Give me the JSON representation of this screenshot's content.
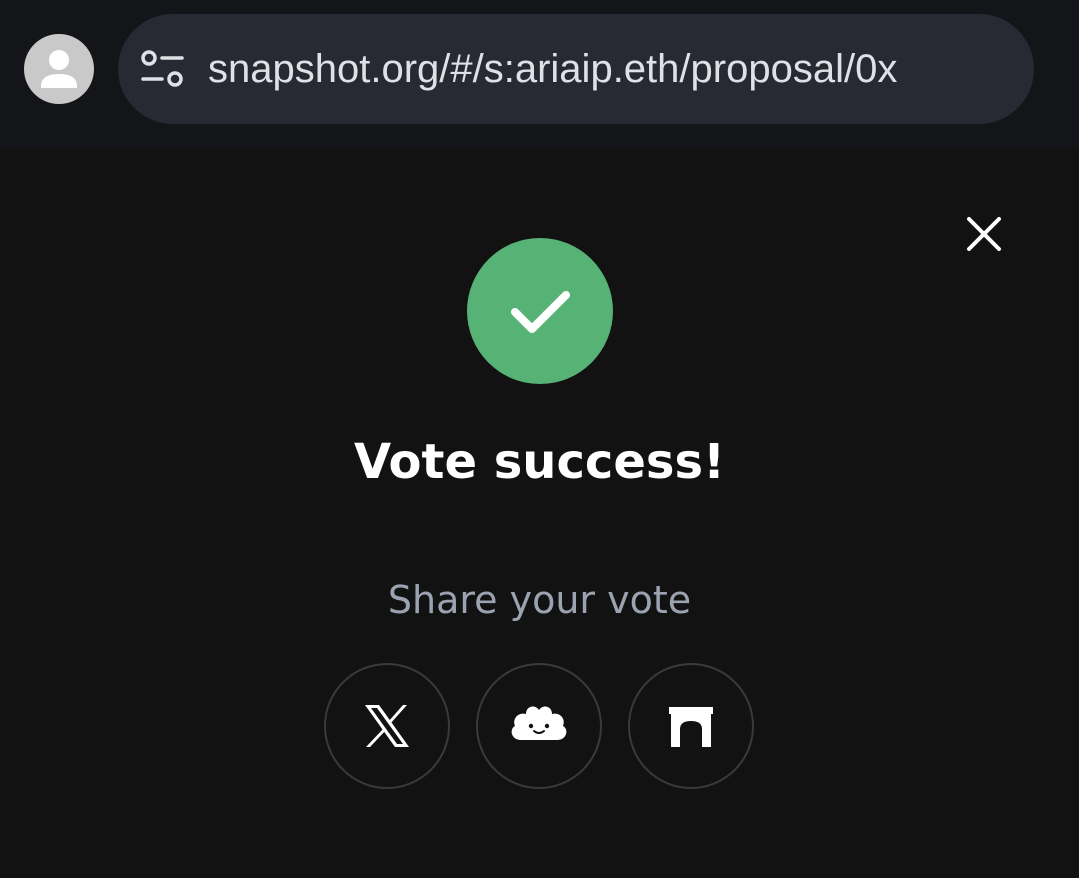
{
  "browser": {
    "url": "snapshot.org/#/s:ariaip.eth/proposal/0x",
    "avatar_icon": "account-circle-icon",
    "site_settings_icon": "tune-icon"
  },
  "modal": {
    "title": "Vote success!",
    "share_label": "Share your vote",
    "close_icon": "close-icon",
    "success_icon": "check-icon",
    "success_color": "#57b276",
    "share_buttons": [
      {
        "icon": "x-twitter-icon"
      },
      {
        "icon": "lens-icon"
      },
      {
        "icon": "farcaster-icon"
      }
    ]
  }
}
